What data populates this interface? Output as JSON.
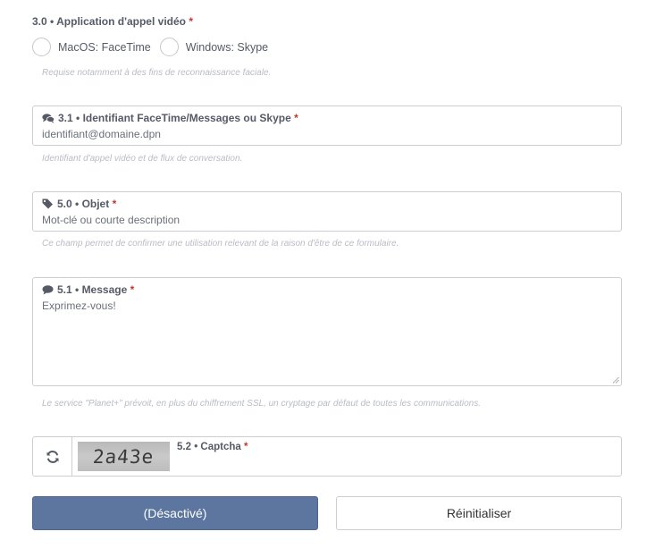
{
  "video_app": {
    "number": "3.0",
    "label": "Application d'appel vidéo",
    "required_mark": "*",
    "options": [
      {
        "label": "MacOS: FaceTime"
      },
      {
        "label": "Windows: Skype"
      }
    ],
    "help": "Requise notamment à des fins de reconnaissance faciale."
  },
  "identifier": {
    "number": "3.1",
    "label": "Identifiant FaceTime/Messages ou Skype",
    "required_mark": "*",
    "placeholder": "identifiant@domaine.dpn",
    "icon": "comments-icon",
    "help": "Identifiant d'appel vidéo et de flux de conversation."
  },
  "subject": {
    "number": "5.0",
    "label": "Objet",
    "required_mark": "*",
    "placeholder": "Mot-clé ou courte description",
    "icon": "tag-icon",
    "help": "Ce champ permet de confirmer une utilisation relevant de la raison d'être de ce formulaire."
  },
  "message": {
    "number": "5.1",
    "label": "Message",
    "required_mark": "*",
    "placeholder": "Exprimez-vous!",
    "icon": "comment-icon",
    "help": "Le service \"Planet+\" prévoit, en plus du chiffrement SSL, un cryptage par défaut de toutes les communications."
  },
  "captcha": {
    "number": "5.2",
    "label": "Captcha",
    "required_mark": "*",
    "code": "2a43e",
    "refresh_icon": "refresh-icon"
  },
  "buttons": {
    "submit": "(Désactivé)",
    "reset": "Réinitialiser"
  },
  "colors": {
    "primary": "#5c76a0",
    "required": "#c0392b",
    "help_text": "#b8bcc4",
    "border": "#ccced4"
  }
}
